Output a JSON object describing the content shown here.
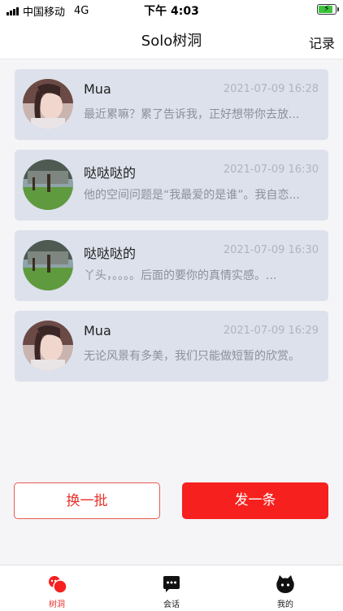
{
  "status_bar": {
    "carrier": "中国移动",
    "network": "4G",
    "time": "下午 4:03"
  },
  "header": {
    "title": "Solo树洞",
    "record_label": "记录"
  },
  "posts": [
    {
      "name": "Mua",
      "time": "2021-07-09 16:28",
      "message": "最近累嘛？累了告诉我，正好想带你去放...",
      "avatar": "girl-avatar"
    },
    {
      "name": "哒哒哒的",
      "time": "2021-07-09 16:30",
      "message": "他的空间问题是“我最爱的是谁”。我自恋...",
      "avatar": "garden-avatar"
    },
    {
      "name": "哒哒哒的",
      "time": "2021-07-09 16:30",
      "message": "丫头，。。。。后面的要你的真情实感。...",
      "avatar": "garden-avatar"
    },
    {
      "name": "Mua",
      "time": "2021-07-09 16:29",
      "message": "无论风景有多美，我们只能做短暂的欣赏。",
      "avatar": "girl-avatar"
    }
  ],
  "actions": {
    "refresh_label": "换一批",
    "post_label": "发一条"
  },
  "tabs": [
    {
      "label": "树洞",
      "icon": "tree-hole-icon",
      "active": true
    },
    {
      "label": "会话",
      "icon": "chat-icon",
      "active": false
    },
    {
      "label": "我的",
      "icon": "profile-icon",
      "active": false
    }
  ],
  "colors": {
    "accent": "#f6201e",
    "card_bg": "#dde1ec",
    "battery": "#3bc43b"
  }
}
